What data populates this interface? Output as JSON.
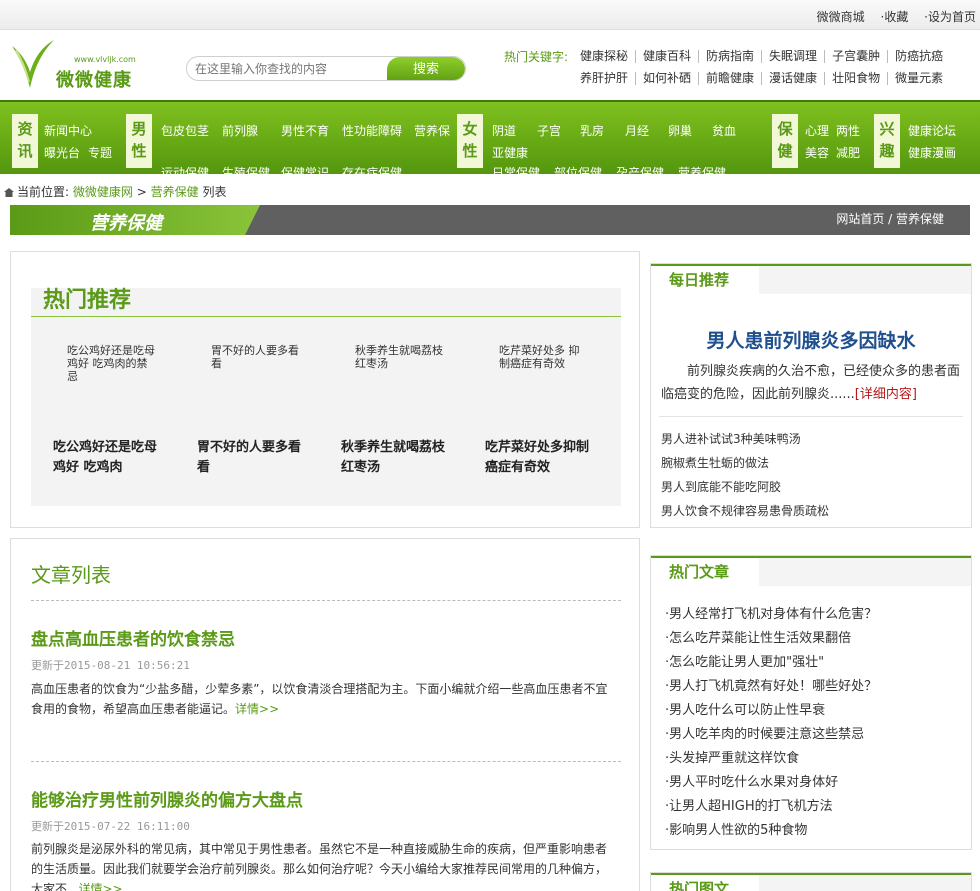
{
  "topbar": {
    "links": [
      "微微商城",
      "·收藏",
      "·设为首页"
    ]
  },
  "logo": {
    "url": "www.vlvljk.com",
    "name": "微微健康"
  },
  "search": {
    "placeholder": "在这里输入你查找的内容",
    "button": "搜索"
  },
  "hotkeys": {
    "label": "热门关键字:",
    "row1": [
      "健康探秘",
      "健康百科",
      "防病指南",
      "失眠调理",
      "子宫囊肿",
      "防癌抗癌"
    ],
    "row2": [
      "养肝护肝",
      "如何补硒",
      "前瞻健康",
      "漫话健康",
      "壮阳食物",
      "微量元素"
    ]
  },
  "nav": {
    "cat1": "资讯",
    "cat1_items": [
      "新闻中心",
      "曝光台",
      "专题"
    ],
    "cat2": "男性",
    "cat2_items": [
      "包皮包茎",
      "前列腺",
      "男性不育",
      "性功能障碍",
      "营养保健",
      "运动保健",
      "生殖保健",
      "保健常识",
      "存在症保健"
    ],
    "cat3": "女性",
    "cat3_items": [
      "阴道",
      "子宫",
      "乳房",
      "月经",
      "卵巢",
      "贫血",
      "亚健康",
      "日常保健",
      "部位保健",
      "孕产保健",
      "营养保健"
    ],
    "cat4": "保健",
    "cat4_items": [
      "心理",
      "两性",
      "美容",
      "减肥"
    ],
    "cat5": "兴趣",
    "cat5_items": [
      "健康论坛",
      "健康漫画"
    ]
  },
  "breadcrumb": {
    "prefix": "当前位置:",
    "home": "微微健康网",
    "section": "营养保健",
    "suffix": "列表"
  },
  "banner": {
    "title": "营养保健",
    "right": "网站首页 / 营养保健"
  },
  "hot": {
    "title": "热门推荐",
    "items": [
      {
        "thumb": "吃公鸡好还是吃母鸡好 吃鸡肉的禁忌",
        "caption": "吃公鸡好还是吃母鸡好 吃鸡肉"
      },
      {
        "thumb": "胃不好的人要多看看",
        "caption": "胃不好的人要多看看"
      },
      {
        "thumb": "秋季养生就喝荔枝红枣汤",
        "caption": "秋季养生就喝荔枝红枣汤"
      },
      {
        "thumb": "吃芹菜好处多 抑制癌症有奇效",
        "caption": "吃芹菜好处多抑制癌症有奇效"
      }
    ]
  },
  "articles": {
    "title": "文章列表",
    "items": [
      {
        "title": "盘点高血压患者的饮食禁忌",
        "date": "更新于2015-08-21 10:56:21",
        "desc": "高血压患者的饮食为“少盐多醋，少荤多素”，以饮食清淡合理搭配为主。下面小编就介绍一些高血压患者不宜食用的食物，希望高血压患者能逼记。",
        "more": "详情>>"
      },
      {
        "title": "能够治疗男性前列腺炎的偏方大盘点",
        "date": "更新于2015-07-22 16:11:00",
        "desc": "前列腺炎是泌尿外科的常见病，其中常见于男性患者。虽然它不是一种直接威胁生命的疾病，但严重影响患者的生活质量。因此我们就要学会治疗前列腺炎。那么如何治疗呢？今天小编给大家推荐民间常用的几种偏方，大家不...",
        "more": "详情>>"
      }
    ]
  },
  "daily": {
    "tab": "每日推荐",
    "title": "男人患前列腺炎多因缺水",
    "desc": "前列腺炎疾病的久治不愈，已经使众多的患者面临癌变的危险，因此前列腺炎......",
    "more": "[详细内容]",
    "list": [
      "男人进补试试3种美味鸭汤",
      "腕椒煮生牡蛎的做法",
      "男人到底能不能吃阿胶",
      "男人饮食不规律容易患骨质疏松"
    ]
  },
  "hotArticles": {
    "tab": "热门文章",
    "list": [
      "·男人经常打飞机对身体有什么危害？",
      "·怎么吃芹菜能让性生活效果翻倍",
      "·怎么吃能让男人更加\"强壮\"",
      "·男人打飞机竟然有好处！哪些好处？",
      "·男人吃什么可以防止性早衰",
      "·男人吃羊肉的时候要注意这些禁忌",
      "·头发掉严重就这样饮食",
      "·男人平时吃什么水果对身体好",
      "·让男人超HIGH的打飞机方法",
      "·影响男人性欲的5种食物"
    ]
  },
  "hotImages": {
    "tab": "热门图文"
  },
  "colors": {
    "brand_green": "#5a9a16",
    "nav_green": "#6bb01a",
    "daily_title": "#1f4f8f"
  }
}
